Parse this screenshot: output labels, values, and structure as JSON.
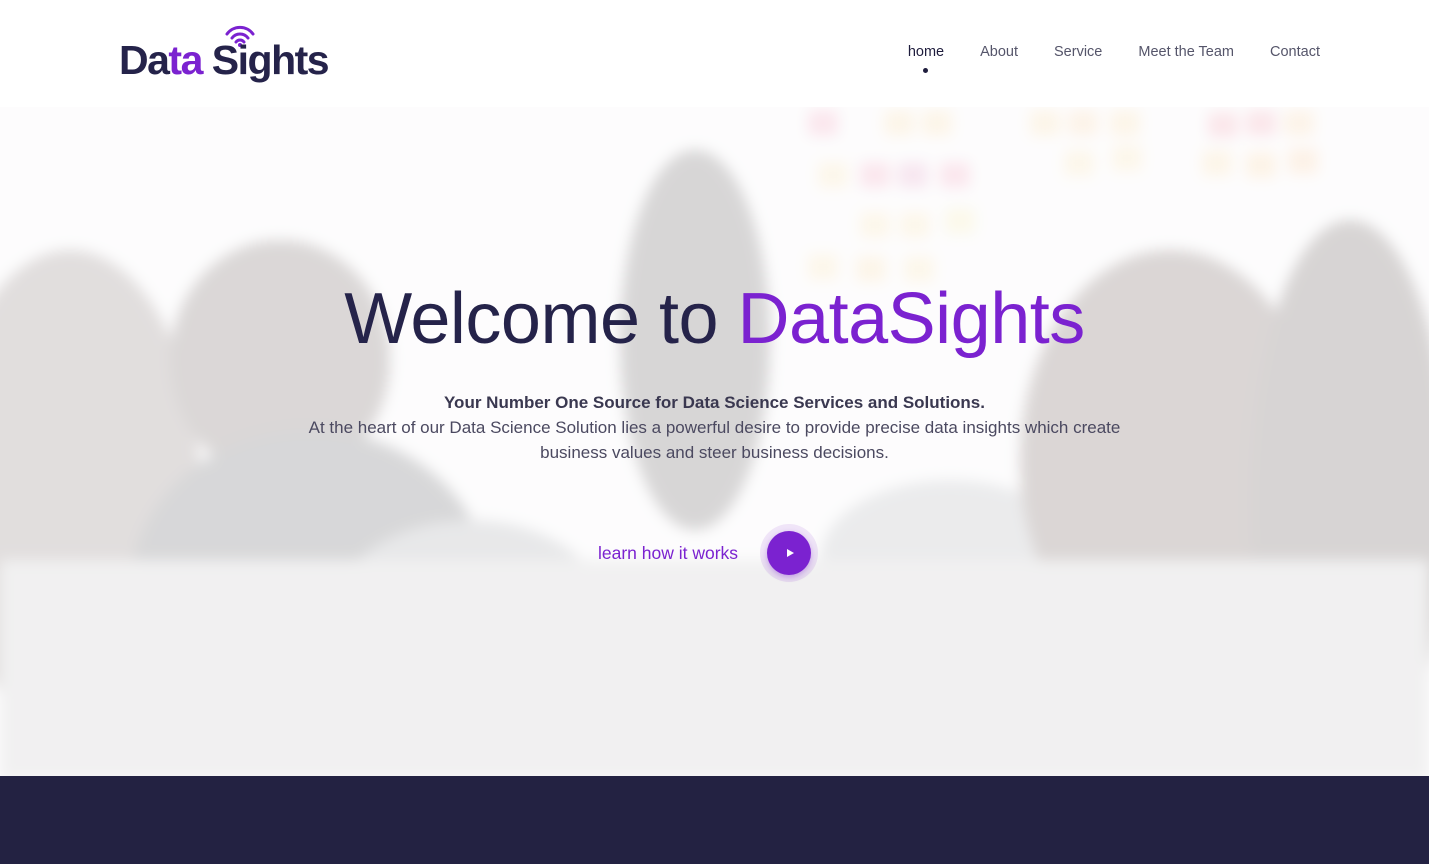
{
  "brand": {
    "logo_part1": "Da",
    "logo_part2": "ta",
    "logo_part3": " Sights",
    "accent_color": "#7b22d0",
    "dark_color": "#25234a"
  },
  "nav": {
    "items": [
      {
        "label": "home",
        "active": true
      },
      {
        "label": "About",
        "active": false
      },
      {
        "label": "Service",
        "active": false
      },
      {
        "label": "Meet the Team",
        "active": false
      },
      {
        "label": "Contact",
        "active": false
      }
    ]
  },
  "hero": {
    "title_prefix": "Welcome to ",
    "title_accent": "DataSights",
    "lead": "Your Number One Source for Data Science Services and Solutions.",
    "description": "At the heart of our Data Science Solution lies a powerful desire to provide precise data insights which create business values and steer business decisions.",
    "cta_label": "learn how it works",
    "play_icon": "play-icon"
  },
  "footer_band": {
    "color": "#232242"
  }
}
